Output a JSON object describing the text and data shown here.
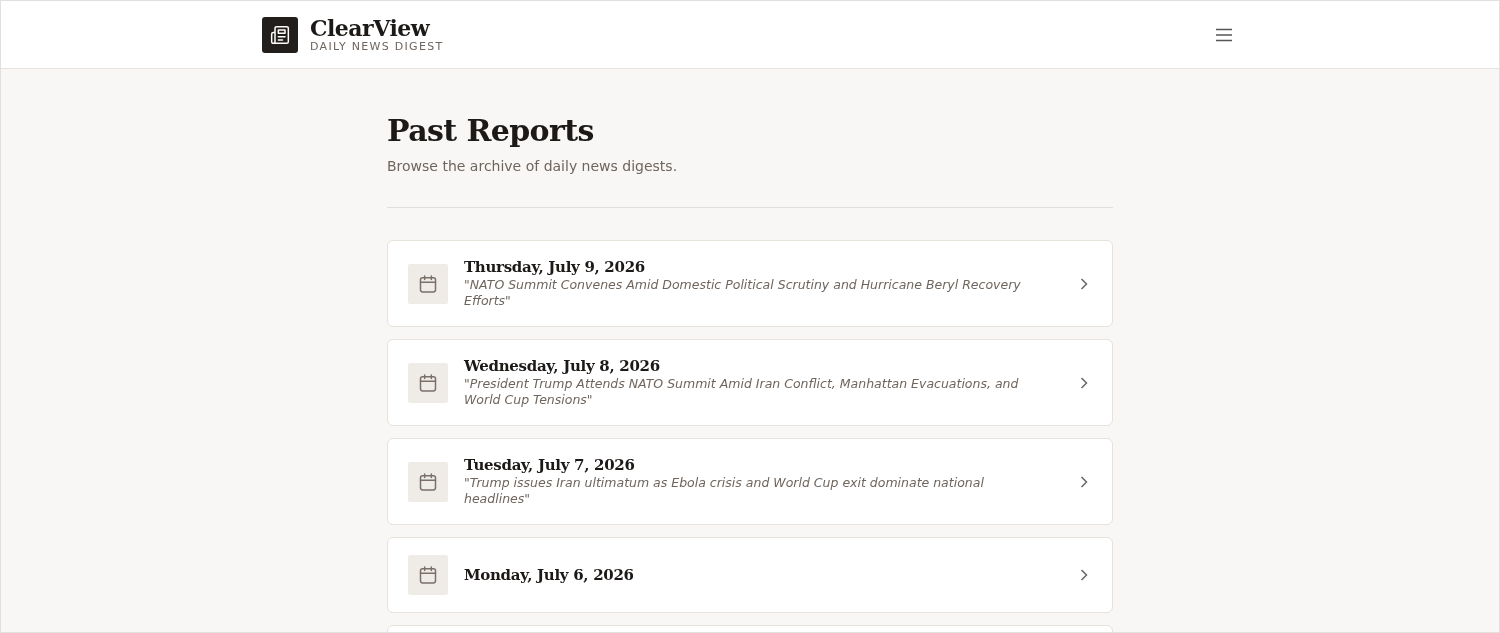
{
  "brand": {
    "name": "ClearView",
    "tagline": "DAILY NEWS DIGEST"
  },
  "page": {
    "title": "Past Reports",
    "subtitle": "Browse the archive of daily news digests."
  },
  "reports": [
    {
      "date": "Thursday, July 9, 2026",
      "headline": "\"NATO Summit Convenes Amid Domestic Political Scrutiny and Hurricane Beryl Recovery Efforts\""
    },
    {
      "date": "Wednesday, July 8, 2026",
      "headline": "\"President Trump Attends NATO Summit Amid Iran Conflict, Manhattan Evacuations, and World Cup Tensions\""
    },
    {
      "date": "Tuesday, July 7, 2026",
      "headline": "\"Trump issues Iran ultimatum as Ebola crisis and World Cup exit dominate national headlines\""
    },
    {
      "date": "Monday, July 6, 2026"
    }
  ]
}
